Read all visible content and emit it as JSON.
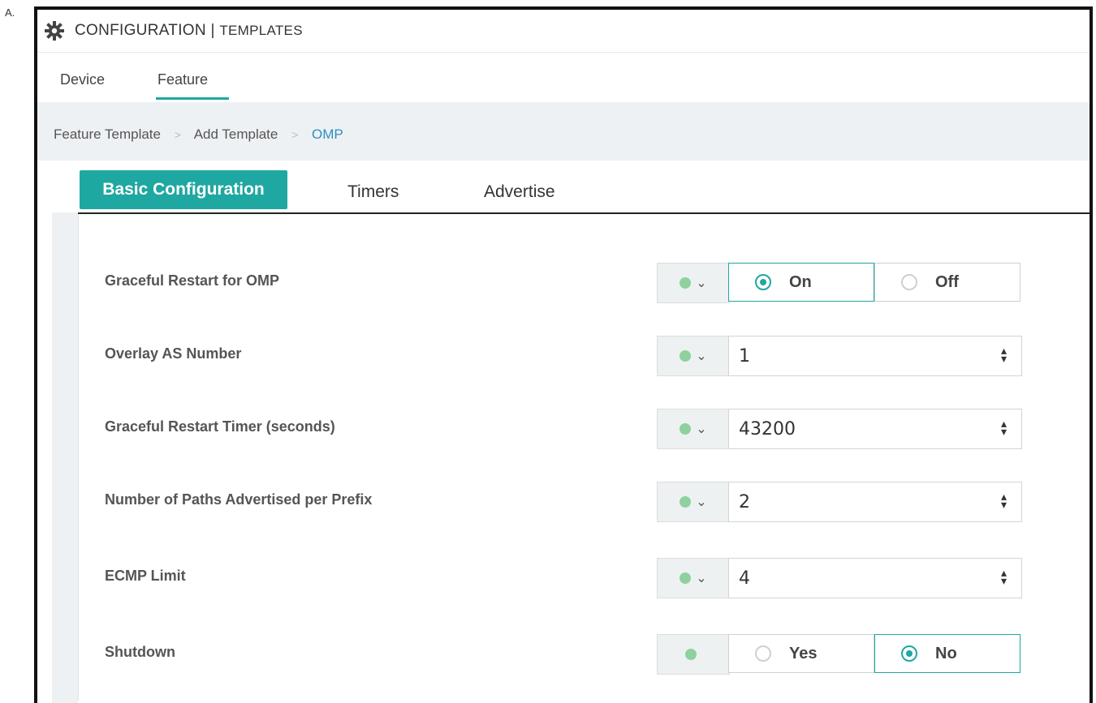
{
  "option_letter": "A.",
  "header": {
    "title": "CONFIGURATION",
    "separator": "|",
    "subtitle": "TEMPLATES"
  },
  "nav_tabs": [
    {
      "label": "Device"
    },
    {
      "label": "Feature"
    }
  ],
  "breadcrumb": {
    "items": [
      "Feature Template",
      "Add Template",
      "OMP"
    ]
  },
  "section_tabs": [
    {
      "label": "Basic Configuration",
      "active": true
    },
    {
      "label": "Timers",
      "active": false
    },
    {
      "label": "Advertise",
      "active": false
    }
  ],
  "fields": [
    {
      "label": "Graceful Restart for OMP",
      "type": "radio",
      "options": [
        "On",
        "Off"
      ],
      "selected": "On"
    },
    {
      "label": "Overlay AS Number",
      "type": "stepper",
      "value": "1"
    },
    {
      "label": "Graceful Restart Timer (seconds)",
      "type": "stepper",
      "value": "43200"
    },
    {
      "label": "Number of Paths Advertised per Prefix",
      "type": "stepper",
      "value": "2"
    },
    {
      "label": "ECMP Limit",
      "type": "stepper",
      "value": "4"
    },
    {
      "label": "Shutdown",
      "type": "radio",
      "options": [
        "Yes",
        "No"
      ],
      "selected": "No"
    }
  ],
  "colors": {
    "accent": "#1fa7a1",
    "breadcrumb_link": "#2f8fc0",
    "globe": "#8fd19e"
  },
  "icons": {
    "header": "gear-icon",
    "scope": "globe-icon",
    "scope_caret": "caret-down-icon"
  }
}
